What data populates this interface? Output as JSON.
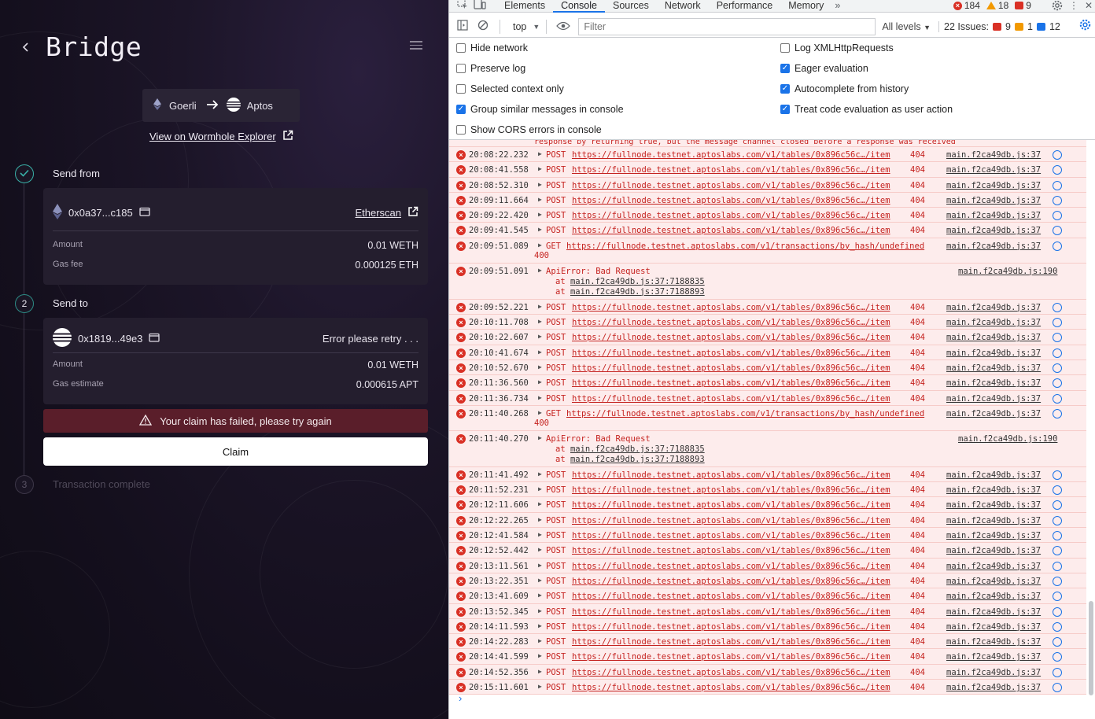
{
  "app": {
    "title": "Bridge",
    "route": {
      "from": "Goerli",
      "to": "Aptos"
    },
    "explorer_link": "View on Wormhole Explorer",
    "steps": [
      {
        "num": "",
        "title": "Send from",
        "state": "done"
      },
      {
        "num": "2",
        "title": "Send to",
        "state": "active"
      },
      {
        "num": "3",
        "title": "Transaction complete",
        "state": "pending"
      }
    ],
    "send_from": {
      "address": "0x0a37...c185",
      "explorer": "Etherscan",
      "rows": [
        {
          "label": "Amount",
          "value": "0.01 WETH"
        },
        {
          "label": "Gas fee",
          "value": "0.000125 ETH"
        }
      ]
    },
    "send_to": {
      "address": "0x1819...49e3",
      "status": "Error please retry . . .",
      "rows": [
        {
          "label": "Amount",
          "value": "0.01 WETH"
        },
        {
          "label": "Gas estimate",
          "value": "0.000615 APT"
        }
      ]
    },
    "alert": "Your claim has failed, please try again",
    "claim_button": "Claim"
  },
  "devtools": {
    "tabs": [
      "Elements",
      "Console",
      "Sources",
      "Network",
      "Performance",
      "Memory"
    ],
    "active_tab": "Console",
    "counts": {
      "errors": "184",
      "warnings": "18",
      "issues": "9"
    },
    "toolbar": {
      "context": "top",
      "filter_placeholder": "Filter",
      "levels": "All levels",
      "issues_label": "22 Issues:",
      "issues_err": "9",
      "issues_warn": "1",
      "issues_info": "12"
    },
    "settings": {
      "left": [
        {
          "label": "Hide network",
          "checked": false
        },
        {
          "label": "Preserve log",
          "checked": false
        },
        {
          "label": "Selected context only",
          "checked": false
        },
        {
          "label": "Group similar messages in console",
          "checked": true
        },
        {
          "label": "Show CORS errors in console",
          "checked": false
        }
      ],
      "right": [
        {
          "label": "Log XMLHttpRequests",
          "checked": false
        },
        {
          "label": "Eager evaluation",
          "checked": true
        },
        {
          "label": "Autocomplete from history",
          "checked": true
        },
        {
          "label": "Treat code evaluation as user action",
          "checked": true
        }
      ]
    },
    "cutoff_text": "response by returning true, but the message channel closed before a response was received",
    "logs": [
      {
        "kind": "req",
        "ts": "20:08:22.232",
        "method": "POST",
        "url": "https://fullnode.testnet.aptoslabs.com/v1/tables/0x896c56c…/item",
        "status": "404",
        "src": "main.f2ca49db.js:37"
      },
      {
        "kind": "req",
        "ts": "20:08:41.558",
        "method": "POST",
        "url": "https://fullnode.testnet.aptoslabs.com/v1/tables/0x896c56c…/item",
        "status": "404",
        "src": "main.f2ca49db.js:37"
      },
      {
        "kind": "req",
        "ts": "20:08:52.310",
        "method": "POST",
        "url": "https://fullnode.testnet.aptoslabs.com/v1/tables/0x896c56c…/item",
        "status": "404",
        "src": "main.f2ca49db.js:37"
      },
      {
        "kind": "req",
        "ts": "20:09:11.664",
        "method": "POST",
        "url": "https://fullnode.testnet.aptoslabs.com/v1/tables/0x896c56c…/item",
        "status": "404",
        "src": "main.f2ca49db.js:37"
      },
      {
        "kind": "req",
        "ts": "20:09:22.420",
        "method": "POST",
        "url": "https://fullnode.testnet.aptoslabs.com/v1/tables/0x896c56c…/item",
        "status": "404",
        "src": "main.f2ca49db.js:37"
      },
      {
        "kind": "req",
        "ts": "20:09:41.545",
        "method": "POST",
        "url": "https://fullnode.testnet.aptoslabs.com/v1/tables/0x896c56c…/item",
        "status": "404",
        "src": "main.f2ca49db.js:37"
      },
      {
        "kind": "get",
        "ts": "20:09:51.089",
        "method": "GET",
        "url": "https://fullnode.testnet.aptoslabs.com/v1/transactions/by_hash/undefined",
        "status": "400",
        "src": "main.f2ca49db.js:37"
      },
      {
        "kind": "api",
        "ts": "20:09:51.091",
        "message": "ApiError: Bad Request",
        "at1": "main.f2ca49db.js:37:7188835",
        "at2": "main.f2ca49db.js:37:7188893",
        "src": "main.f2ca49db.js:190"
      },
      {
        "kind": "req",
        "ts": "20:09:52.221",
        "method": "POST",
        "url": "https://fullnode.testnet.aptoslabs.com/v1/tables/0x896c56c…/item",
        "status": "404",
        "src": "main.f2ca49db.js:37"
      },
      {
        "kind": "req",
        "ts": "20:10:11.708",
        "method": "POST",
        "url": "https://fullnode.testnet.aptoslabs.com/v1/tables/0x896c56c…/item",
        "status": "404",
        "src": "main.f2ca49db.js:37"
      },
      {
        "kind": "req",
        "ts": "20:10:22.607",
        "method": "POST",
        "url": "https://fullnode.testnet.aptoslabs.com/v1/tables/0x896c56c…/item",
        "status": "404",
        "src": "main.f2ca49db.js:37"
      },
      {
        "kind": "req",
        "ts": "20:10:41.674",
        "method": "POST",
        "url": "https://fullnode.testnet.aptoslabs.com/v1/tables/0x896c56c…/item",
        "status": "404",
        "src": "main.f2ca49db.js:37"
      },
      {
        "kind": "req",
        "ts": "20:10:52.670",
        "method": "POST",
        "url": "https://fullnode.testnet.aptoslabs.com/v1/tables/0x896c56c…/item",
        "status": "404",
        "src": "main.f2ca49db.js:37"
      },
      {
        "kind": "req",
        "ts": "20:11:36.560",
        "method": "POST",
        "url": "https://fullnode.testnet.aptoslabs.com/v1/tables/0x896c56c…/item",
        "status": "404",
        "src": "main.f2ca49db.js:37"
      },
      {
        "kind": "req",
        "ts": "20:11:36.734",
        "method": "POST",
        "url": "https://fullnode.testnet.aptoslabs.com/v1/tables/0x896c56c…/item",
        "status": "404",
        "src": "main.f2ca49db.js:37"
      },
      {
        "kind": "get",
        "ts": "20:11:40.268",
        "method": "GET",
        "url": "https://fullnode.testnet.aptoslabs.com/v1/transactions/by_hash/undefined",
        "status": "400",
        "src": "main.f2ca49db.js:37"
      },
      {
        "kind": "api",
        "ts": "20:11:40.270",
        "message": "ApiError: Bad Request",
        "at1": "main.f2ca49db.js:37:7188835",
        "at2": "main.f2ca49db.js:37:7188893",
        "src": "main.f2ca49db.js:190"
      },
      {
        "kind": "req",
        "ts": "20:11:41.492",
        "method": "POST",
        "url": "https://fullnode.testnet.aptoslabs.com/v1/tables/0x896c56c…/item",
        "status": "404",
        "src": "main.f2ca49db.js:37"
      },
      {
        "kind": "req",
        "ts": "20:11:52.231",
        "method": "POST",
        "url": "https://fullnode.testnet.aptoslabs.com/v1/tables/0x896c56c…/item",
        "status": "404",
        "src": "main.f2ca49db.js:37"
      },
      {
        "kind": "req",
        "ts": "20:12:11.606",
        "method": "POST",
        "url": "https://fullnode.testnet.aptoslabs.com/v1/tables/0x896c56c…/item",
        "status": "404",
        "src": "main.f2ca49db.js:37"
      },
      {
        "kind": "req",
        "ts": "20:12:22.265",
        "method": "POST",
        "url": "https://fullnode.testnet.aptoslabs.com/v1/tables/0x896c56c…/item",
        "status": "404",
        "src": "main.f2ca49db.js:37"
      },
      {
        "kind": "req",
        "ts": "20:12:41.584",
        "method": "POST",
        "url": "https://fullnode.testnet.aptoslabs.com/v1/tables/0x896c56c…/item",
        "status": "404",
        "src": "main.f2ca49db.js:37"
      },
      {
        "kind": "req",
        "ts": "20:12:52.442",
        "method": "POST",
        "url": "https://fullnode.testnet.aptoslabs.com/v1/tables/0x896c56c…/item",
        "status": "404",
        "src": "main.f2ca49db.js:37"
      },
      {
        "kind": "req",
        "ts": "20:13:11.561",
        "method": "POST",
        "url": "https://fullnode.testnet.aptoslabs.com/v1/tables/0x896c56c…/item",
        "status": "404",
        "src": "main.f2ca49db.js:37"
      },
      {
        "kind": "req",
        "ts": "20:13:22.351",
        "method": "POST",
        "url": "https://fullnode.testnet.aptoslabs.com/v1/tables/0x896c56c…/item",
        "status": "404",
        "src": "main.f2ca49db.js:37"
      },
      {
        "kind": "req",
        "ts": "20:13:41.609",
        "method": "POST",
        "url": "https://fullnode.testnet.aptoslabs.com/v1/tables/0x896c56c…/item",
        "status": "404",
        "src": "main.f2ca49db.js:37"
      },
      {
        "kind": "req",
        "ts": "20:13:52.345",
        "method": "POST",
        "url": "https://fullnode.testnet.aptoslabs.com/v1/tables/0x896c56c…/item",
        "status": "404",
        "src": "main.f2ca49db.js:37"
      },
      {
        "kind": "req",
        "ts": "20:14:11.593",
        "method": "POST",
        "url": "https://fullnode.testnet.aptoslabs.com/v1/tables/0x896c56c…/item",
        "status": "404",
        "src": "main.f2ca49db.js:37"
      },
      {
        "kind": "req",
        "ts": "20:14:22.283",
        "method": "POST",
        "url": "https://fullnode.testnet.aptoslabs.com/v1/tables/0x896c56c…/item",
        "status": "404",
        "src": "main.f2ca49db.js:37"
      },
      {
        "kind": "req",
        "ts": "20:14:41.599",
        "method": "POST",
        "url": "https://fullnode.testnet.aptoslabs.com/v1/tables/0x896c56c…/item",
        "status": "404",
        "src": "main.f2ca49db.js:37"
      },
      {
        "kind": "req",
        "ts": "20:14:52.356",
        "method": "POST",
        "url": "https://fullnode.testnet.aptoslabs.com/v1/tables/0x896c56c…/item",
        "status": "404",
        "src": "main.f2ca49db.js:37"
      },
      {
        "kind": "req",
        "ts": "20:15:11.601",
        "method": "POST",
        "url": "https://fullnode.testnet.aptoslabs.com/v1/tables/0x896c56c…/item",
        "status": "404",
        "src": "main.f2ca49db.js:37"
      }
    ],
    "prompt_symbol": "›"
  },
  "colors": {
    "accent": "#1a73e8",
    "error": "#c5221f",
    "error_bg": "#fdecec",
    "step_done": "#39b1a8",
    "alert_bg": "#5a1e2a"
  },
  "icons": [
    "back-arrow-icon",
    "menu-icon",
    "ethereum-icon",
    "aptos-icon",
    "arrow-right-icon",
    "external-link-icon",
    "check-icon",
    "wallet-icon",
    "warning-icon",
    "error-icon",
    "globe-icon",
    "settings-gear-icon"
  ]
}
